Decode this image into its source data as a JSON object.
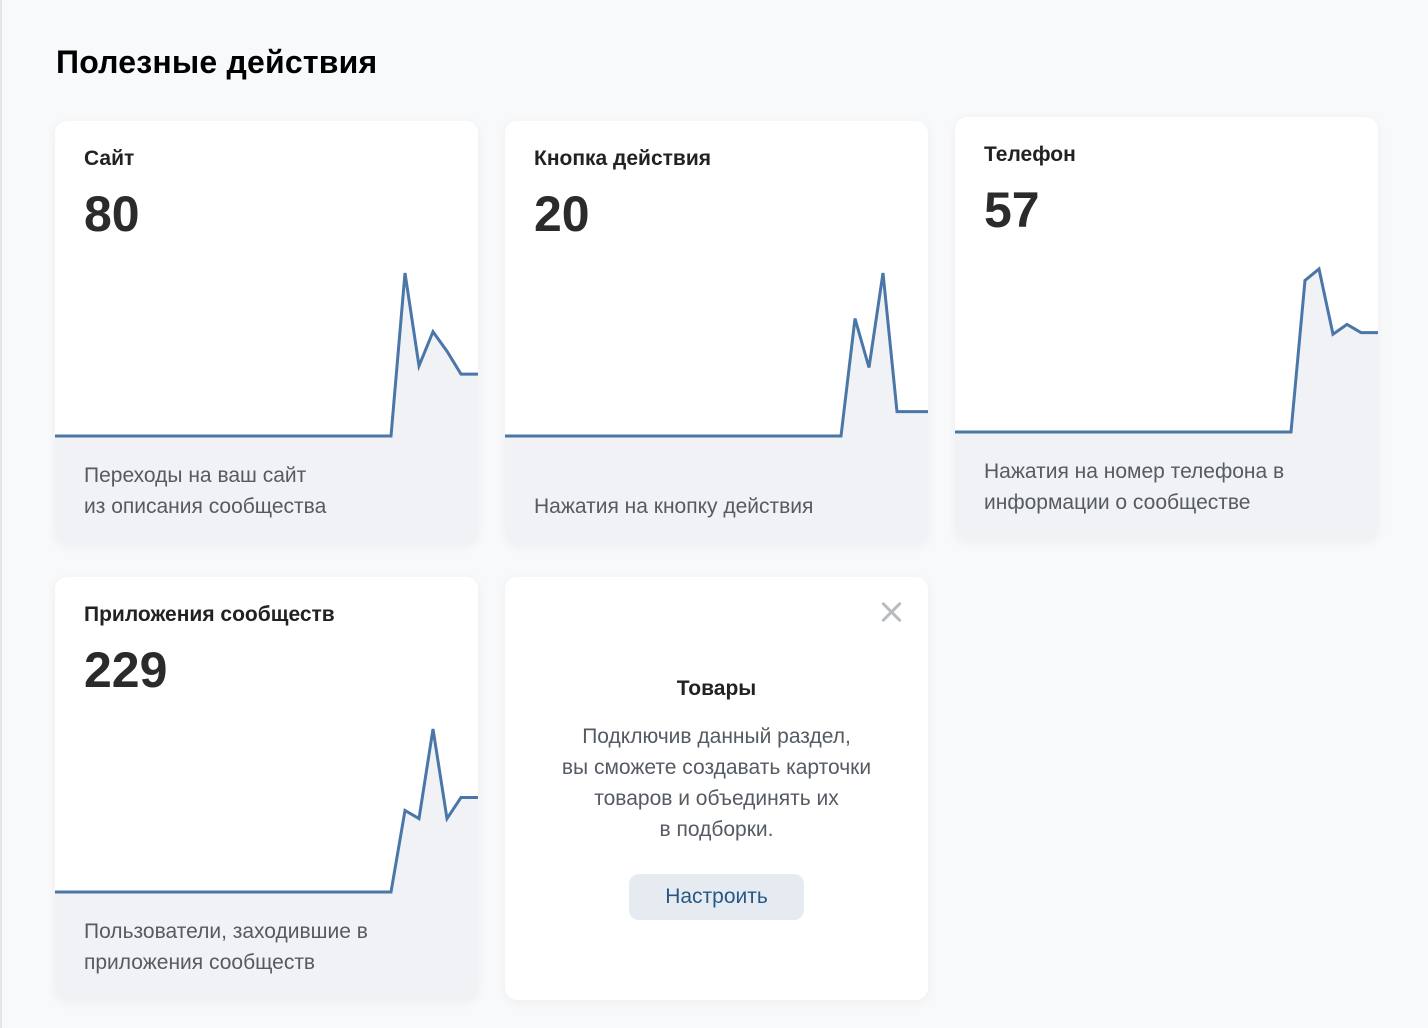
{
  "section": {
    "title": "Полезные действия"
  },
  "colors": {
    "line": "#4a76a8",
    "fill": "#f0f2f5",
    "button_text": "#2a5885",
    "button_bg": "#e5ebf1"
  },
  "cards": [
    {
      "label": "Сайт",
      "value": "80",
      "description": [
        "Переходы на ваш сайт",
        "из описания сообщества"
      ],
      "trend": [
        0,
        0,
        0,
        0,
        0,
        0,
        0,
        0,
        0,
        0,
        0,
        0,
        0,
        0,
        0,
        0,
        0,
        0,
        0,
        0,
        0,
        0,
        0,
        0,
        0,
        1.0,
        0.43,
        0.64,
        0.52,
        0.38
      ]
    },
    {
      "label": "Кнопка действия",
      "value": "20",
      "description": [
        "Нажатия на кнопку действия"
      ],
      "trend": [
        0,
        0,
        0,
        0,
        0,
        0,
        0,
        0,
        0,
        0,
        0,
        0,
        0,
        0,
        0,
        0,
        0,
        0,
        0,
        0,
        0,
        0,
        0,
        0,
        0,
        0.72,
        0.42,
        1.0,
        0.15
      ]
    },
    {
      "label": "Телефон",
      "value": "57",
      "description": [
        "Нажатия на номер телефона в",
        "информации о сообществе"
      ],
      "trend": [
        0,
        0,
        0,
        0,
        0,
        0,
        0,
        0,
        0,
        0,
        0,
        0,
        0,
        0,
        0,
        0,
        0,
        0,
        0,
        0,
        0,
        0,
        0,
        0,
        0,
        0.93,
        1.0,
        0.6,
        0.66,
        0.61
      ]
    },
    {
      "label": "Приложения сообществ",
      "value": "229",
      "description": [
        "Пользователи, заходившие в",
        "приложения сообществ"
      ],
      "trend": [
        0,
        0,
        0,
        0,
        0,
        0,
        0,
        0,
        0,
        0,
        0,
        0,
        0,
        0,
        0,
        0,
        0,
        0,
        0,
        0,
        0,
        0,
        0,
        0,
        0,
        0.5,
        0.45,
        1.0,
        0.45,
        0.58
      ]
    }
  ],
  "promo": {
    "title": "Товары",
    "text": [
      "Подключив данный раздел,",
      "вы сможете создавать карточки",
      "товаров и объединять их",
      "в подборки."
    ],
    "button_label": "Настроить",
    "close_icon": "close-icon"
  }
}
